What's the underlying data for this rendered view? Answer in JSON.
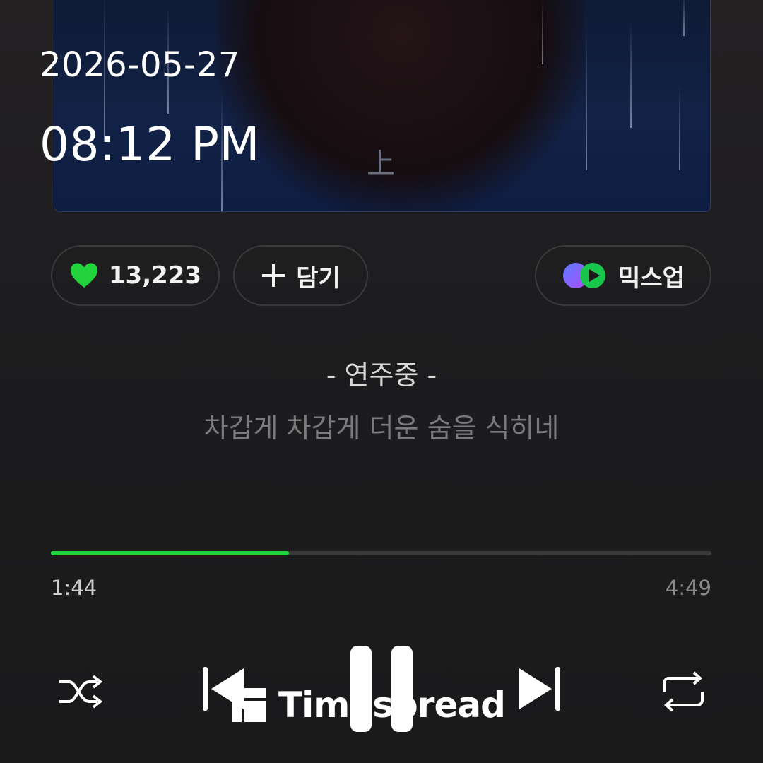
{
  "overlay": {
    "date": "2026-05-27",
    "time": "08:12 PM"
  },
  "album_art": {
    "caption_glyph": "上"
  },
  "actions": {
    "like_count": "13,223",
    "add_label": "담기",
    "mixup_label": "믹스업"
  },
  "lyrics": {
    "status": "- 연주중 -",
    "line": "차갑게 차갑게 더운 숨을 식히네"
  },
  "progress": {
    "elapsed": "1:44",
    "total": "4:49",
    "fraction": 0.36
  },
  "controls": {
    "shuffle_icon": "shuffle-icon",
    "prev_icon": "skip-previous-icon",
    "pause_icon": "pause-icon",
    "next_icon": "skip-next-icon",
    "repeat_icon": "repeat-icon"
  },
  "watermark": {
    "text": "Timespread"
  },
  "colors": {
    "accent_green": "#22d33c",
    "background": "#1b1b1c",
    "text_primary": "#ffffff",
    "text_muted": "#7a7a7c"
  }
}
